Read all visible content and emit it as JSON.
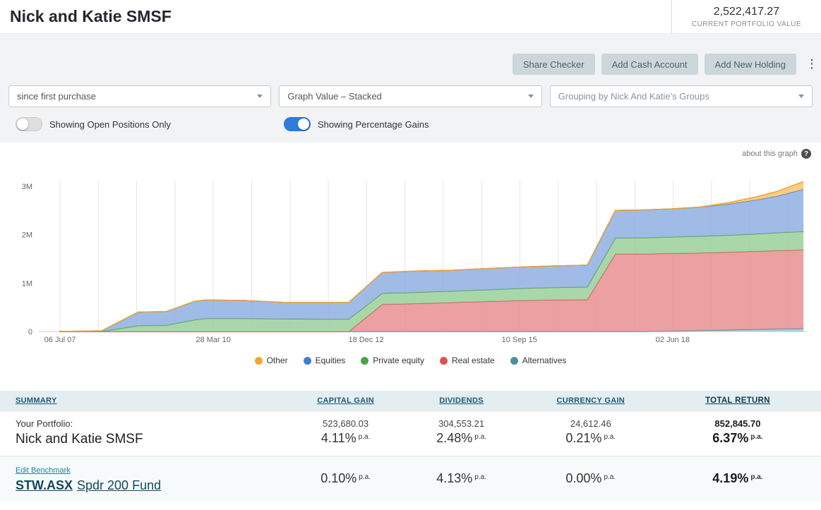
{
  "header": {
    "title": "Nick and Katie SMSF",
    "portfolio_value": "2,522,417.27",
    "portfolio_value_label": "CURRENT PORTFOLIO VALUE"
  },
  "toolbar": {
    "buttons": [
      "Share Checker",
      "Add Cash Account",
      "Add New Holding"
    ]
  },
  "icons": {
    "kebab": "⋮",
    "question": "?"
  },
  "filters": {
    "date_range": "since first purchase",
    "graph_type": "Graph Value – Stacked",
    "grouping": "Grouping by Nick And Katie's Groups"
  },
  "toggles": [
    {
      "label": "Showing Open Positions Only",
      "state": "off"
    },
    {
      "label": "Showing Percentage Gains",
      "state": "on"
    }
  ],
  "chart": {
    "about_link": "about this graph"
  },
  "chart_data": {
    "type": "area",
    "stacked": true,
    "title": "",
    "xlabel": "",
    "ylabel": "",
    "ylim": [
      0,
      3100000
    ],
    "grid": "vertical",
    "legend_position": "bottom",
    "x_years": [
      2007.5,
      2008.25,
      2008.9,
      2009.4,
      2009.9,
      2010.1,
      2010.8,
      2011.5,
      2012.2,
      2012.65,
      2013.25,
      2013.9,
      2014.5,
      2015.1,
      2015.7,
      2016.2,
      2016.9,
      2017.4,
      2017.9,
      2018.4,
      2018.9,
      2019.4,
      2019.9,
      2020.3,
      2020.75
    ],
    "x_tick_years": [
      2007.51,
      2010.24,
      2012.96,
      2015.69,
      2018.42
    ],
    "x_tick_labels": [
      "06 Jul 07",
      "28 Mar 10",
      "18 Dec 12",
      "10 Sep 15",
      "02 Jun 18"
    ],
    "y_ticks": [
      {
        "value": 0,
        "label": "0"
      },
      {
        "value": 1000000,
        "label": "1M"
      },
      {
        "value": 2000000,
        "label": "2M"
      },
      {
        "value": 3000000,
        "label": "3M"
      }
    ],
    "series": [
      {
        "name": "Alternatives",
        "fill": "#9cc4d0",
        "stroke": "#5292a8",
        "values": [
          0,
          0,
          0,
          0,
          0,
          0,
          0,
          0,
          0,
          0,
          0,
          0,
          0,
          0,
          0,
          0,
          0,
          0,
          0,
          12000,
          22000,
          32000,
          45000,
          55000,
          65000
        ]
      },
      {
        "name": "Real estate",
        "fill": "#e89090",
        "stroke": "#cf5b5b",
        "values": [
          0,
          0,
          0,
          0,
          0,
          0,
          0,
          0,
          0,
          0,
          560000,
          580000,
          600000,
          620000,
          640000,
          650000,
          660000,
          1600000,
          1600000,
          1600000,
          1600000,
          1605000,
          1610000,
          1615000,
          1620000
        ]
      },
      {
        "name": "Private equity",
        "fill": "#9bd09a",
        "stroke": "#56a556",
        "values": [
          0,
          5000,
          120000,
          130000,
          240000,
          270000,
          270000,
          260000,
          255000,
          255000,
          230000,
          230000,
          235000,
          240000,
          250000,
          255000,
          260000,
          330000,
          335000,
          340000,
          345000,
          350000,
          360000,
          370000,
          380000
        ]
      },
      {
        "name": "Equities",
        "fill": "#8fb0e2",
        "stroke": "#5585cf",
        "values": [
          0,
          10000,
          280000,
          280000,
          380000,
          380000,
          370000,
          340000,
          345000,
          345000,
          430000,
          440000,
          430000,
          440000,
          440000,
          445000,
          450000,
          570000,
          575000,
          580000,
          600000,
          640000,
          700000,
          760000,
          870000
        ]
      },
      {
        "name": "Other",
        "fill": "#f8c66d",
        "stroke": "#f0a030",
        "values": [
          0,
          0,
          0,
          0,
          0,
          0,
          0,
          0,
          0,
          0,
          0,
          0,
          0,
          0,
          0,
          0,
          0,
          0,
          0,
          0,
          0,
          30000,
          60000,
          100000,
          160000
        ]
      }
    ],
    "legend": [
      {
        "name": "Other",
        "color": "#f5a52f"
      },
      {
        "name": "Equities",
        "color": "#3d7fd6"
      },
      {
        "name": "Private equity",
        "color": "#4aa54a"
      },
      {
        "name": "Real estate",
        "color": "#d9534f"
      },
      {
        "name": "Alternatives",
        "color": "#4d8da3"
      }
    ]
  },
  "summary_table": {
    "headers": [
      "SUMMARY",
      "CAPITAL GAIN",
      "DIVIDENDS",
      "CURRENCY GAIN",
      "TOTAL RETURN"
    ],
    "pa_suffix": "p.a.",
    "rows": [
      {
        "label_small": "Your Portfolio:",
        "label_main": "Nick and Katie SMSF",
        "capital_gain_amount": "523,680.03",
        "capital_gain_pct": "4.11%",
        "dividends_amount": "304,553.21",
        "dividends_pct": "2.48%",
        "currency_gain_amount": "24,612.46",
        "currency_gain_pct": "0.21%",
        "total_return_amount": "852,845.70",
        "total_return_pct": "6.37%"
      },
      {
        "label_small": "Edit Benchmark",
        "benchmark_code": "STW.ASX",
        "benchmark_name": "Spdr 200 Fund",
        "capital_gain_pct": "0.10%",
        "dividends_pct": "4.13%",
        "currency_gain_pct": "0.00%",
        "total_return_pct": "4.19%"
      }
    ]
  }
}
